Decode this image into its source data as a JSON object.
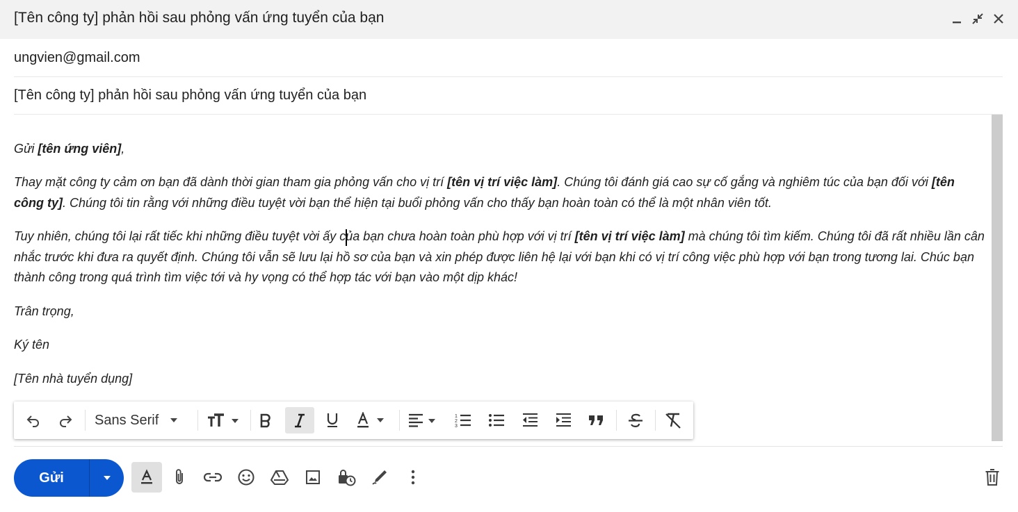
{
  "window": {
    "title": "[Tên công ty] phản hồi sau phỏng vấn ứng tuyển của bạn",
    "controls": [
      "minimize-icon",
      "exit-fullscreen-icon",
      "close-icon"
    ]
  },
  "compose": {
    "to": "ungvien@gmail.com",
    "subject": "[Tên công ty] phản hồi sau phỏng vấn ứng tuyển của bạn"
  },
  "body": {
    "greeting_prefix": "Gửi ",
    "greeting_name": "[tên ứng viên]",
    "greeting_suffix": ",",
    "p1_a": "Thay mặt công ty cảm ơn bạn đã dành thời gian tham gia phỏng vấn cho vị trí ",
    "p1_b": "[tên vị trí việc làm]",
    "p1_c": ". Chúng tôi đánh giá cao sự cố gắng và nghiêm túc của bạn đối với ",
    "p1_d": "[tên công ty]",
    "p1_e": ". Chúng tôi tin rằng với những điều tuyệt vời bạn thể hiện tại buổi phỏng vấn cho thấy bạn hoàn toàn có thể là một nhân viên tốt.",
    "p2_a": "Tuy nhiên, chúng tôi lại rất tiếc khi những điều tuyệt vời ấy của bạn chưa hoàn toàn phù hợp với vị trí ",
    "p2_b": "[tên vị trí việc làm]",
    "p2_c": " mà chúng tôi tìm kiếm. Chúng tôi đã rất nhiều lần cân nhắc trước khi đưa ra quyết định. Chúng tôi vẫn sẽ lưu lại hồ sơ của bạn và xin phép được liên hệ lại với bạn khi có vị trí công việc phù hợp với bạn trong tương lai. Chúc bạn thành công trong quá trình tìm việc tới và hy vọng có thể hợp tác với bạn vào một dịp khác!",
    "regards": "Trân trọng,",
    "signature": "Ký tên",
    "recruiter": "[Tên nhà tuyển dụng]"
  },
  "format_toolbar": {
    "font": "Sans Serif",
    "icons": [
      "undo-icon",
      "redo-icon",
      "font-dropdown-icon",
      "text-size-icon",
      "bold-icon",
      "italic-icon",
      "underline-icon",
      "text-color-icon",
      "align-icon",
      "numbered-list-icon",
      "bulleted-list-icon",
      "indent-less-icon",
      "indent-more-icon",
      "quote-icon",
      "strikethrough-icon",
      "remove-formatting-icon"
    ],
    "active": [
      "italic-icon"
    ]
  },
  "bottom_toolbar": {
    "send_label": "Gửi",
    "icons": [
      "send-options-icon",
      "formatting-options-icon",
      "attach-icon",
      "link-icon",
      "emoji-icon",
      "drive-icon",
      "photo-icon",
      "confidential-icon",
      "signature-icon",
      "more-options-icon",
      "trash-icon"
    ]
  },
  "colors": {
    "send_blue": "#0b57d0",
    "titlebar_bg": "#f2f2f2",
    "active_button_bg": "#e5e5e5"
  }
}
